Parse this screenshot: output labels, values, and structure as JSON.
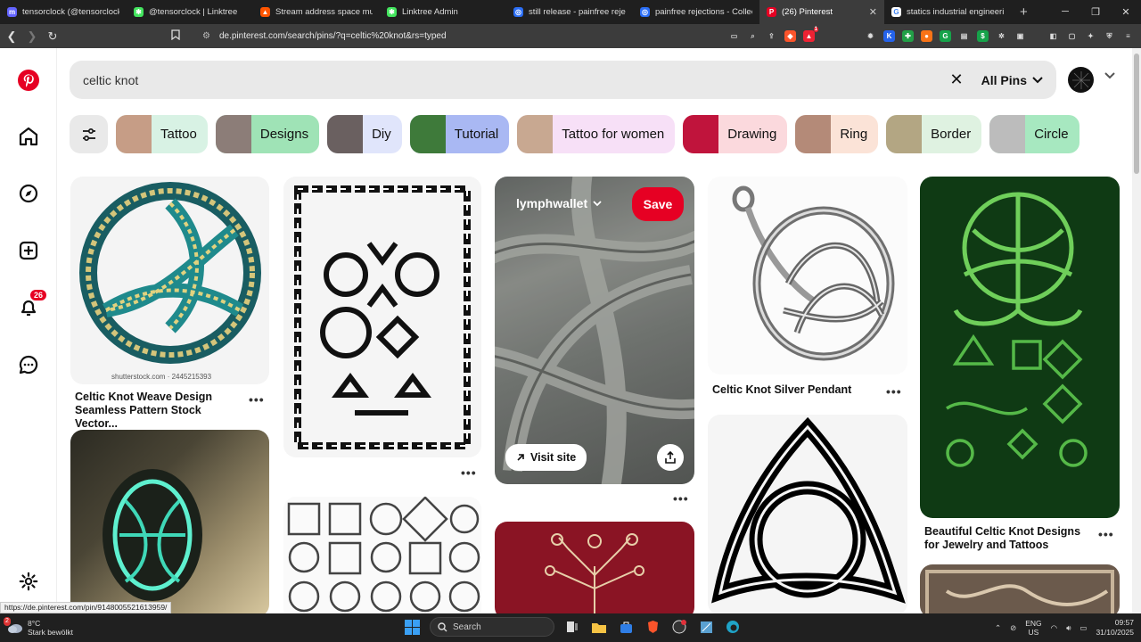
{
  "browser": {
    "tabs": [
      {
        "title": "tensorclock (@tensorclock@m",
        "color": "#6364ff",
        "glyph": "m"
      },
      {
        "title": "@tensorclock | Linktree",
        "color": "#43e55e",
        "glyph": "✱"
      },
      {
        "title": "Stream address space music | t",
        "color": "#ff5500",
        "glyph": "▲"
      },
      {
        "title": "Linktree Admin",
        "color": "#43e55e",
        "glyph": "✱"
      },
      {
        "title": "still release - painfree rejection",
        "color": "#2b6ef5",
        "glyph": "◎"
      },
      {
        "title": "painfree rejections - Collection",
        "color": "#2b6ef5",
        "glyph": "◎"
      },
      {
        "title": "(26) Pinterest",
        "color": "#e60023",
        "glyph": "P"
      },
      {
        "title": "statics industrial engineering -",
        "color": "#ffffff",
        "glyph": "G"
      }
    ],
    "url": "de.pinterest.com/search/pins/?q=celtic%20knot&rs=typed",
    "status_url": "https://de.pinterest.com/pin/914800552161​3959/",
    "brave_badge": "1"
  },
  "rail": {
    "notifications_count": "26"
  },
  "search": {
    "query": "celtic knot",
    "filter_label": "All Pins"
  },
  "chips": [
    {
      "label": "Tattoo",
      "bg": "#d8f2e4",
      "thumb": "#c69d86"
    },
    {
      "label": "Designs",
      "bg": "#9fe3b6",
      "thumb": "#8c7d78"
    },
    {
      "label": "Diy",
      "bg": "#e0e5fb",
      "thumb": "#6a6060"
    },
    {
      "label": "Tutorial",
      "bg": "#a9b8f3",
      "thumb": "#3e7a3a"
    },
    {
      "label": "Tattoo for women",
      "bg": "#f7e0f7",
      "thumb": "#c8a891"
    },
    {
      "label": "Drawing",
      "bg": "#fbd9dd",
      "thumb": "#c0143c"
    },
    {
      "label": "Ring",
      "bg": "#fbe3d7",
      "thumb": "#b48a78"
    },
    {
      "label": "Border",
      "bg": "#dff2e1",
      "thumb": "#b3a683"
    },
    {
      "label": "Circle",
      "bg": "#a7e8c0",
      "thumb": "#bcbcbc"
    },
    {
      "label": "",
      "bg": "#f3f3f3",
      "thumb": "#ffffff"
    }
  ],
  "pins": {
    "weave": {
      "title": "Celtic Knot Weave Design Seamless Pattern Stock Vector...",
      "watermark": "shutterstock.com · 2445215393"
    },
    "stone": {
      "board": "lymphwallet",
      "save": "Save",
      "visit": "Visit site"
    },
    "pendant": {
      "title": "Celtic Knot Silver Pendant"
    },
    "tree": {
      "title": "Beautiful Celtic Knot Designs for Jewelry and Tattoos"
    },
    "more_glyph": "•••"
  },
  "taskbar": {
    "temp": "8°C",
    "weather": "Stark bewölkt",
    "weather_badge": "2",
    "search_label": "Search",
    "lang_top": "ENG",
    "lang_bottom": "US",
    "time": "09:57",
    "date": "31/10/2025"
  }
}
